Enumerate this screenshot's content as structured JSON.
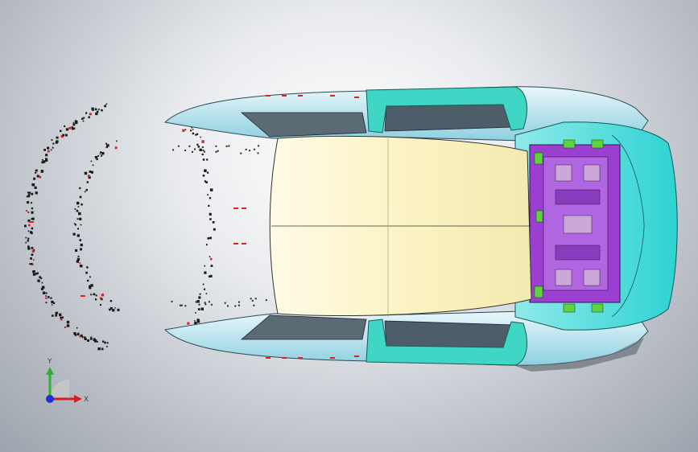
{
  "viewport": {
    "background_center": "#ffffff",
    "background_edge": "#9ea4ad"
  },
  "model": {
    "parts": [
      {
        "name": "roof-panel",
        "color": "#fbf3c4"
      },
      {
        "name": "body-side-panel",
        "color": "#a7dce8"
      },
      {
        "name": "door-frame",
        "color": "#3fd6c6"
      },
      {
        "name": "rear-closure-panel",
        "color": "#36d6d4"
      },
      {
        "name": "rear-cross-member",
        "color": "#9a3fd0"
      },
      {
        "name": "brackets",
        "color": "#5ed33d"
      },
      {
        "name": "fastener-markers",
        "color": "#e02020"
      }
    ]
  },
  "triad": {
    "x_label": "X",
    "y_label": "Y",
    "x_color": "#d42020",
    "y_color": "#2fb02f",
    "z_color": "#2030d0"
  }
}
